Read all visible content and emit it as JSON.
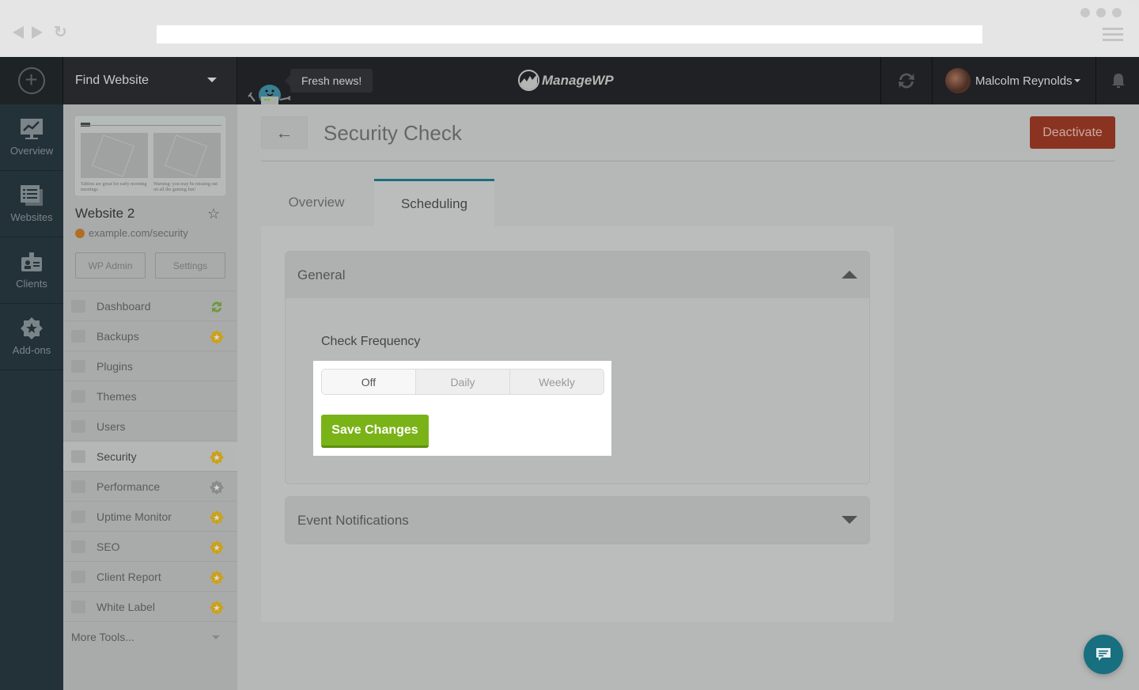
{
  "browser": {
    "url": ""
  },
  "topbar": {
    "find_website": "Find Website",
    "news": "Fresh news!",
    "logo": "ManageWP",
    "user_name": "Malcolm Reynolds"
  },
  "leftnav": [
    {
      "label": "Overview",
      "icon": "chart-monitor-icon"
    },
    {
      "label": "Websites",
      "icon": "websites-list-icon"
    },
    {
      "label": "Clients",
      "icon": "id-badge-icon"
    },
    {
      "label": "Add-ons",
      "icon": "star-badge-icon"
    }
  ],
  "website": {
    "thumbnail_captions": [
      "Tablets are great for early morning meetings",
      "Warning: you may be missing out on all the gaming fun!"
    ],
    "name": "Website 2",
    "url": "example.com/security",
    "wp_admin": "WP Admin",
    "settings": "Settings"
  },
  "tools": [
    {
      "label": "Dashboard",
      "icon": "monitor-icon",
      "badge": "sync"
    },
    {
      "label": "Backups",
      "icon": "backup-drive-icon",
      "badge": "premium"
    },
    {
      "label": "Plugins",
      "icon": "plug-icon",
      "badge": ""
    },
    {
      "label": "Themes",
      "icon": "palette-icon",
      "badge": ""
    },
    {
      "label": "Users",
      "icon": "users-icon",
      "badge": ""
    },
    {
      "label": "Security",
      "icon": "shield-icon",
      "badge": "premium",
      "active": true
    },
    {
      "label": "Performance",
      "icon": "gauge-icon",
      "badge": "premium-inactive"
    },
    {
      "label": "Uptime Monitor",
      "icon": "arrow-up-icon",
      "badge": "premium"
    },
    {
      "label": "SEO",
      "icon": "megaphone-icon",
      "badge": "premium"
    },
    {
      "label": "Client Report",
      "icon": "area-chart-icon",
      "badge": "premium"
    },
    {
      "label": "White Label",
      "icon": "tag-icon",
      "badge": "premium"
    }
  ],
  "more_tools": "More Tools...",
  "main": {
    "title": "Security Check",
    "deactivate": "Deactivate",
    "tabs": [
      {
        "label": "Overview",
        "active": false
      },
      {
        "label": "Scheduling",
        "active": true
      }
    ],
    "general": {
      "title": "General",
      "field_label": "Check Frequency",
      "options": [
        "Off",
        "Daily",
        "Weekly"
      ],
      "selected": "Off",
      "save": "Save Changes"
    },
    "event_notifications": {
      "title": "Event Notifications"
    }
  },
  "colors": {
    "accent": "#1b6f80",
    "danger": "#8a3320",
    "success": "#7ab317",
    "premium_badge": "#c9a21e"
  }
}
